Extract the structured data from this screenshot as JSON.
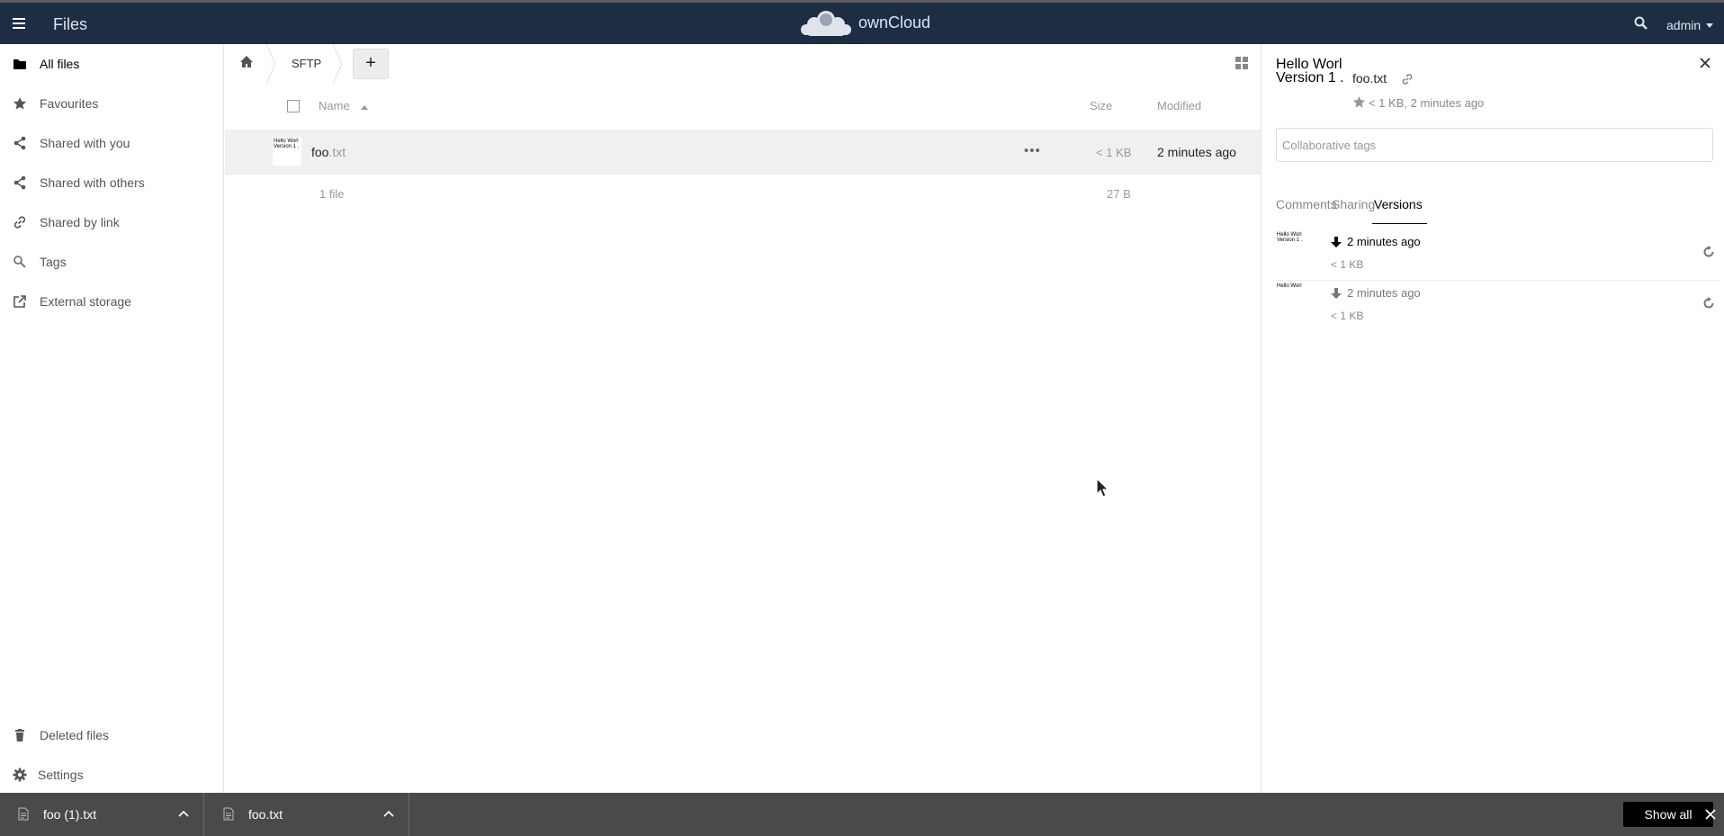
{
  "header": {
    "app_name": "Files",
    "brand": "ownCloud",
    "user": "admin",
    "bg_color": "#1d2d44"
  },
  "sidebar": {
    "items": [
      {
        "label": "All files",
        "icon": "folder-icon",
        "active": true
      },
      {
        "label": "Favourites",
        "icon": "star-icon"
      },
      {
        "label": "Shared with you",
        "icon": "share-icon"
      },
      {
        "label": "Shared with others",
        "icon": "share-icon"
      },
      {
        "label": "Shared by link",
        "icon": "link-icon"
      },
      {
        "label": "Tags",
        "icon": "tag-search-icon"
      },
      {
        "label": "External storage",
        "icon": "external-icon"
      }
    ],
    "bottom": [
      {
        "label": "Deleted files",
        "icon": "trash-icon"
      },
      {
        "label": "Settings",
        "icon": "gear-icon"
      }
    ]
  },
  "breadcrumb": {
    "folder": "SFTP",
    "new_label": "+"
  },
  "file_list": {
    "columns": {
      "name": "Name",
      "size": "Size",
      "modified": "Modified"
    },
    "rows": [
      {
        "name": "foo",
        "ext": ".txt",
        "thumb_lines": [
          "Hello Worl",
          "Version 1 ."
        ],
        "size": "< 1 KB",
        "modified": "2 minutes ago"
      }
    ],
    "summary": {
      "count": "1 file",
      "size": "27 B"
    }
  },
  "details": {
    "title_line1": "Hello Worl",
    "title_line2": "Version 1 .",
    "filename": "foo.txt",
    "meta": "< 1 KB, 2 minutes ago",
    "tags_placeholder": "Collaborative tags",
    "tabs": [
      "Comments",
      "Sharing",
      "Versions"
    ],
    "active_tab": "Versions",
    "versions": [
      {
        "thumb_lines": [
          "Hello Worl",
          "Version 1 ."
        ],
        "time": "2 minutes ago",
        "size": "< 1 KB",
        "current": true
      },
      {
        "thumb_lines": [
          "Hello Worl"
        ],
        "time": "2 minutes ago",
        "size": "< 1 KB",
        "current": false
      }
    ]
  },
  "downloads": {
    "items": [
      {
        "name": "foo (1).txt"
      },
      {
        "name": "foo.txt"
      }
    ],
    "show_all": "Show all"
  }
}
